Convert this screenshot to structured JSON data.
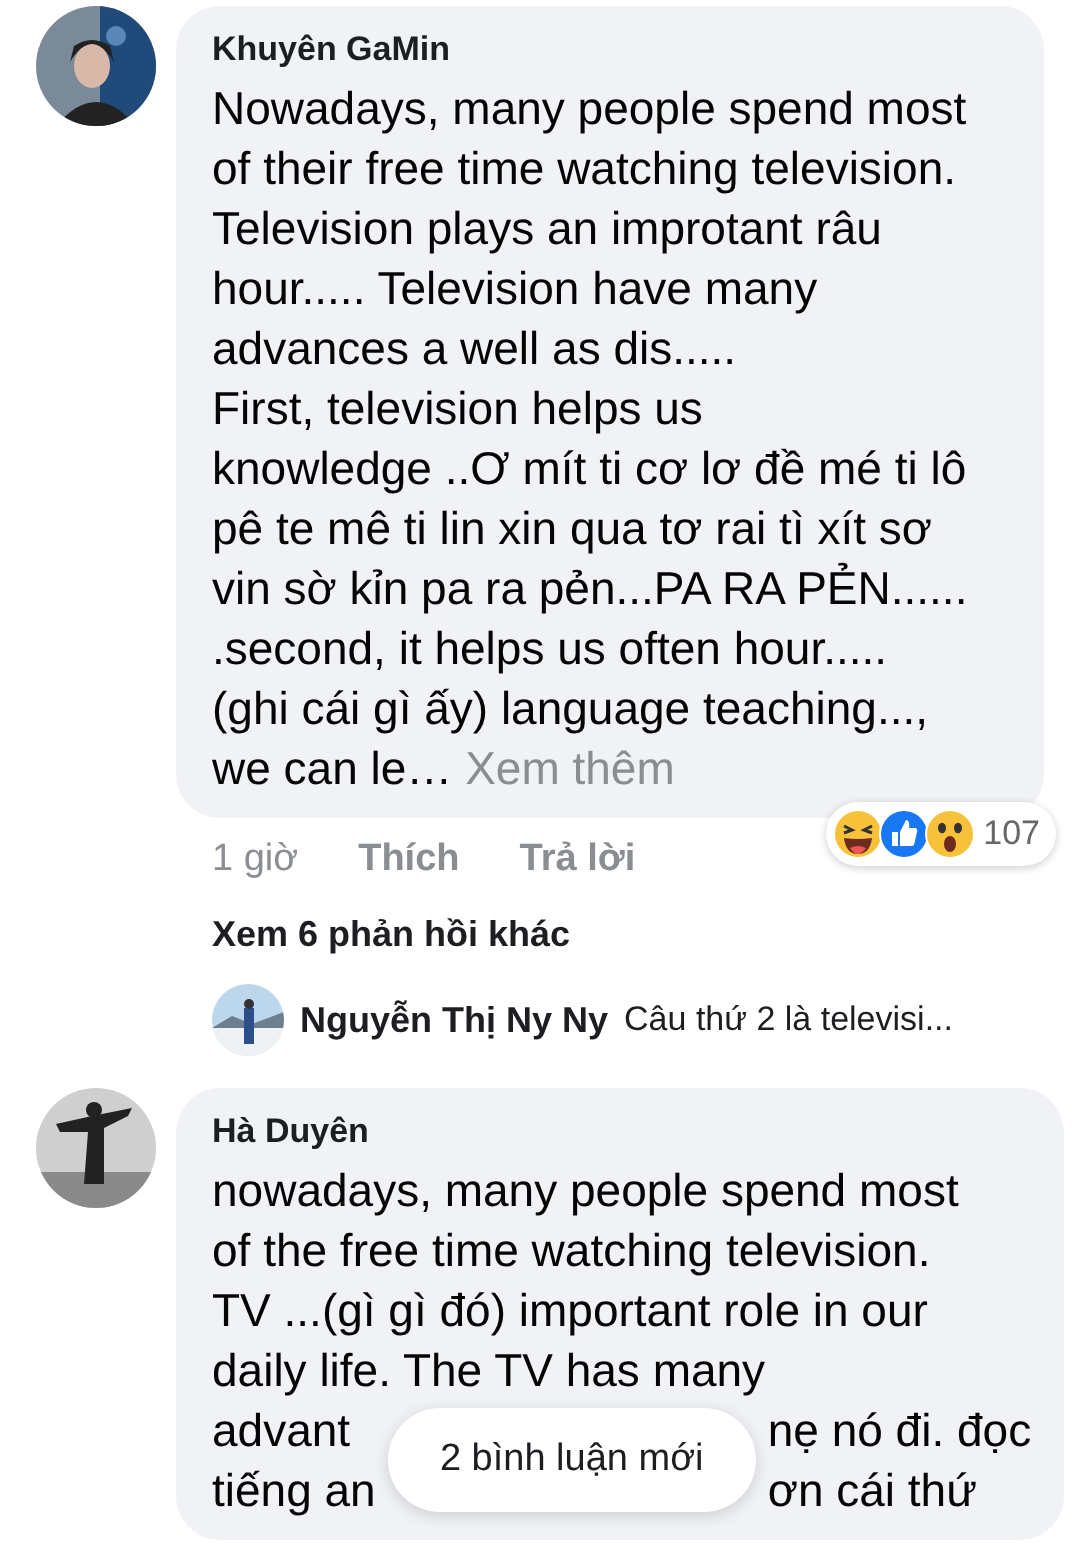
{
  "comments": [
    {
      "author": "Khuyên GaMin",
      "lines": [
        [
          "Nowadays, many people spend most"
        ],
        [
          "of their free time watching television."
        ],
        [
          "Television plays an improtant râu"
        ],
        [
          "hour..... Television have many"
        ],
        [
          "advances  a well as dis....."
        ],
        [
          "First, television helps us"
        ],
        [
          "knowledge ..Ơ mít ti cơ lơ đề mé ti lô"
        ],
        [
          "pê te mê ti lin xin qua tơ rai tì xít sơ"
        ],
        [
          "vin sờ kỉn pa ra pẻn...PA RA PẺN......"
        ],
        [
          ".second, it helps  us  often hour....."
        ],
        [
          "(ghi cái gì ấy) language teaching...,"
        ],
        [
          "we can le…"
        ]
      ],
      "see_more": "Xem thêm",
      "time": "1 giờ",
      "like": "Thích",
      "reply": "Trả lời",
      "reaction_count": "107",
      "more_replies": "Xem 6 phản hồi khác",
      "reply_preview": {
        "author": "Nguyễn Thị Ny Ny",
        "text": "Câu thứ 2 là televisi..."
      }
    },
    {
      "author": "Hà Duyên",
      "lines": [
        [
          "nowadays, many people spend most"
        ],
        [
          "of the free time watching television."
        ],
        [
          "TV ...(gì gì đó) important role in our"
        ],
        [
          "daily life. The TV has many"
        ],
        [
          "advant",
          "nẹ nó đi. đọc"
        ],
        [
          "tiếng an",
          "ơn cái thứ"
        ]
      ]
    }
  ],
  "toast": "2 bình luận mới"
}
